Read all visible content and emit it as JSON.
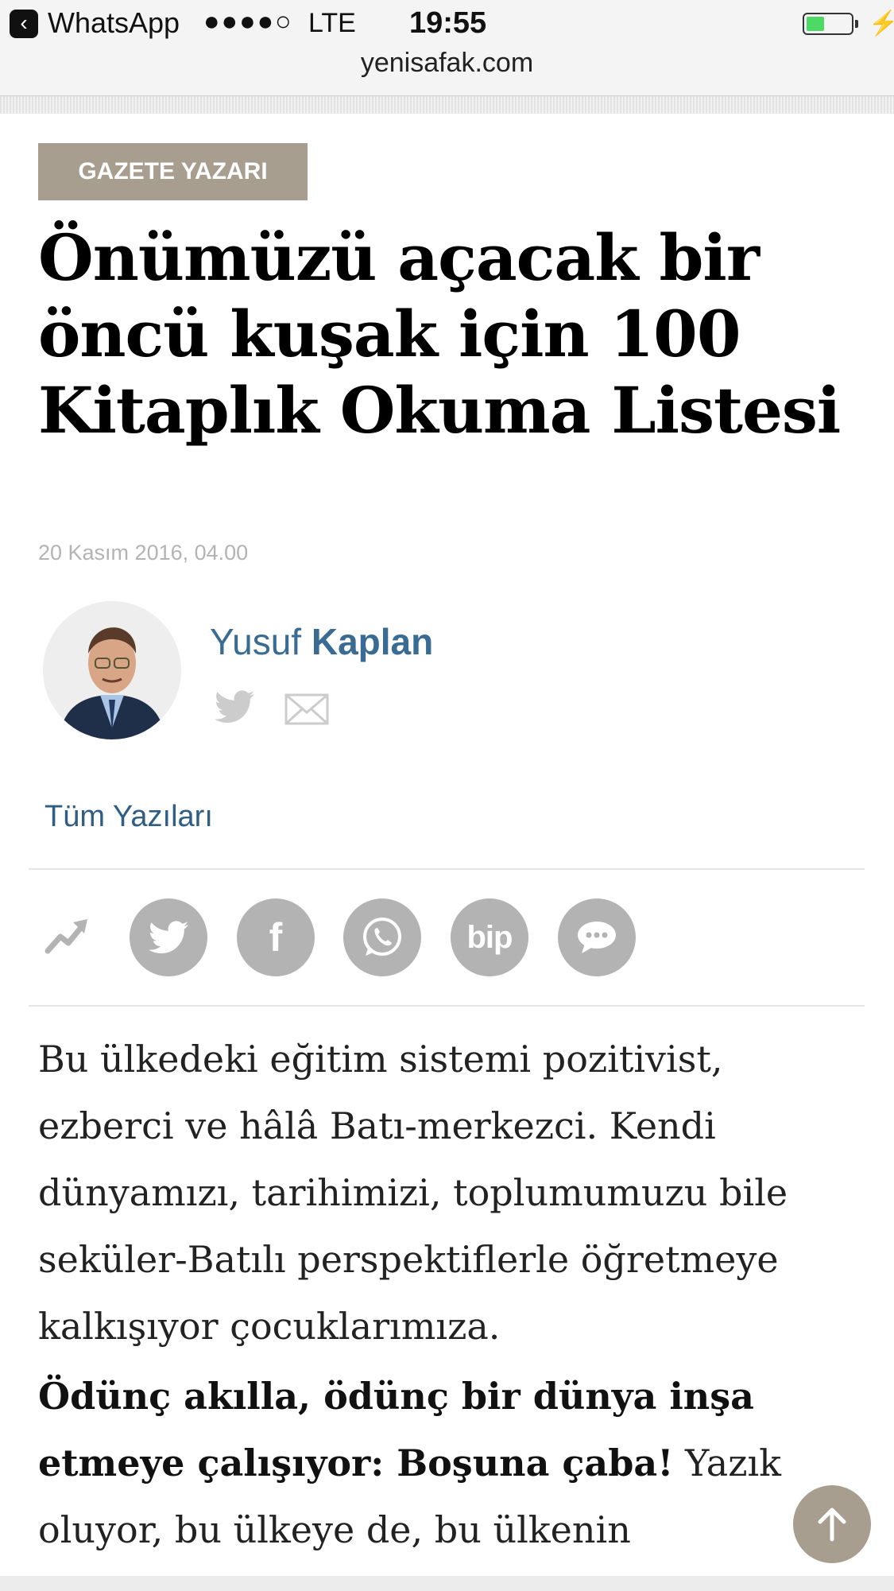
{
  "status_bar": {
    "back_app": "WhatsApp",
    "signal": "●●●●○",
    "network": "LTE",
    "time": "19:55",
    "url": "yenisafak.com",
    "battery_color": "#4cd964"
  },
  "article": {
    "category": "GAZETE YAZARI",
    "headline": "Önümüzü açacak bir öncü kuşak için 100 Kitaplık Okuma Listesi",
    "date": "20 Kasım 2016, 04.00"
  },
  "author": {
    "first_name": "Yusuf",
    "last_name": "Kaplan",
    "all_posts_link": "Tüm Yazıları",
    "icons": [
      "twitter-icon",
      "mail-icon"
    ]
  },
  "share_bar": {
    "icons": [
      "trending-icon",
      "twitter-icon",
      "facebook-icon",
      "whatsapp-icon",
      "bip-icon",
      "message-icon"
    ],
    "bip_label": "bip",
    "facebook_label": "f"
  },
  "body": {
    "paragraph1": "Bu ülkedeki eğitim sistemi pozitivist, ezberci ve hâlâ Batı-merkezci. Kendi dünyamızı, tarihimizi, toplumumuzu bile seküler-Batılı perspektiflerle öğretmeye kalkışıyor çocuklarımıza.",
    "paragraph2_bold": "Ödünç akılla, ödünç bir dünya inşa etmeye çalışıyor: Boşuna çaba!",
    "paragraph2_rest": " Yazık oluyor, bu ülkeye de, bu ülkenin"
  },
  "colors": {
    "accent_tag": "#a89e8f",
    "author_blue": "#3a6b92",
    "share_gray": "#b3b3b3"
  }
}
